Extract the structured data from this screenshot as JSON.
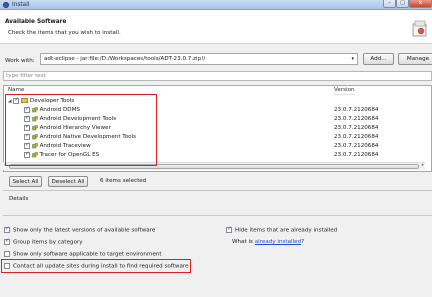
{
  "window": {
    "title": "Install"
  },
  "banner": {
    "title": "Available Software",
    "description": "Check the items that you wish to install."
  },
  "work_with": {
    "label": "Work with:",
    "value": "adt-eclipse - jar:file:/D:/Workspaces/tools/ADT-23.0.7.zip!/",
    "add_label": "Add...",
    "manage_label": "Manage"
  },
  "filter": {
    "placeholder": "type filter text"
  },
  "tree": {
    "headers": {
      "name": "Name",
      "version": "Version"
    },
    "group": {
      "label": "Developer Tools",
      "checked": true
    },
    "items": [
      {
        "label": "Android DDMS",
        "version": "23.0.7.2120684",
        "checked": true
      },
      {
        "label": "Android Development Tools",
        "version": "23.0.7.2120684",
        "checked": true
      },
      {
        "label": "Android Hierarchy Viewer",
        "version": "23.0.7.2120684",
        "checked": true
      },
      {
        "label": "Android Native Development Tools",
        "version": "23.0.7.2120684",
        "checked": true
      },
      {
        "label": "Android Traceview",
        "version": "23.0.7.2120684",
        "checked": true
      },
      {
        "label": "Tracer for OpenGL ES",
        "version": "23.0.7.2120684",
        "checked": true
      }
    ]
  },
  "selection": {
    "select_all": "Select All",
    "deselect_all": "Deselect All",
    "count_text": "6 items selected"
  },
  "details": {
    "label": "Details"
  },
  "options": {
    "latest_versions": {
      "label": "Show only the latest versions of available software",
      "checked": true
    },
    "group_by_category": {
      "label": "Group items by category",
      "checked": true
    },
    "applicable_only": {
      "label": "Show only software applicable to target environment",
      "checked": false
    },
    "contact_sites": {
      "label": "Contact all update sites during install to find required software",
      "checked": false
    },
    "hide_installed": {
      "label": "Hide items that are already installed",
      "checked": true
    },
    "what_is": {
      "prefix": "What is ",
      "link": "already installed",
      "suffix": "?"
    }
  },
  "colors": {
    "annotation": "#e02020",
    "link": "#1f4fd8",
    "titlebar": "#a9c3e6"
  }
}
